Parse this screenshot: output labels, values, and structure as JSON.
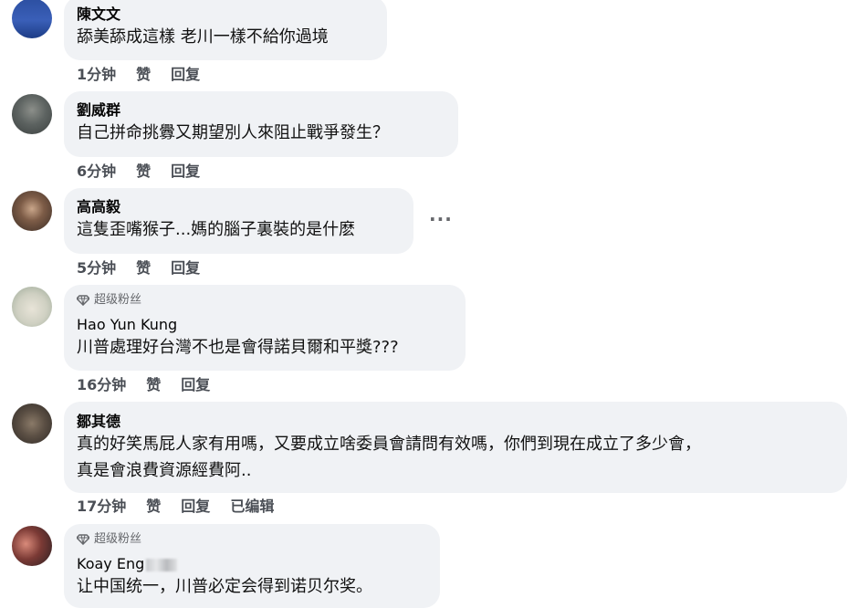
{
  "comments": [
    {
      "author": "陳文文",
      "badge": "",
      "text": [
        "舔美舔成這樣 老川一樣不給你過境"
      ],
      "time": "1分钟",
      "like": "赞",
      "reply": "回复",
      "edited": ""
    },
    {
      "author": "劉威群",
      "badge": "",
      "text": [
        "自己拼命挑釁又期望別人來阻止戰爭發生？"
      ],
      "time": "6分钟",
      "like": "赞",
      "reply": "回复",
      "edited": ""
    },
    {
      "author": "高高毅",
      "badge": "",
      "text": [
        "這隻歪嘴猴子...媽的腦子裏裝的是什麽"
      ],
      "time": "5分钟",
      "like": "赞",
      "reply": "回复",
      "edited": ""
    },
    {
      "author": "Hao Yun Kung",
      "badge": "超级粉丝",
      "text": [
        "川普處理好台灣不也是會得諾貝爾和平獎???"
      ],
      "time": "16分钟",
      "like": "赞",
      "reply": "回复",
      "edited": ""
    },
    {
      "author": "鄒其德",
      "badge": "",
      "text": [
        "真的好笑馬屁人家有用嗎，又要成立啥委員會請問有效嗎，你們到現在成立了多少會，",
        "真是會浪費資源經費阿.."
      ],
      "time": "17分钟",
      "like": "赞",
      "reply": "回复",
      "edited": "已编辑"
    },
    {
      "author": "Koay Eng",
      "badge": "超级粉丝",
      "text": [
        "让中国统一，川普必定会得到诺贝尔奖。"
      ],
      "time": "",
      "like": "",
      "reply": "",
      "edited": ""
    }
  ],
  "more_icon": "more-options-icon",
  "colors": {
    "bubble": "#f0f2f5",
    "meta": "#65676b"
  }
}
